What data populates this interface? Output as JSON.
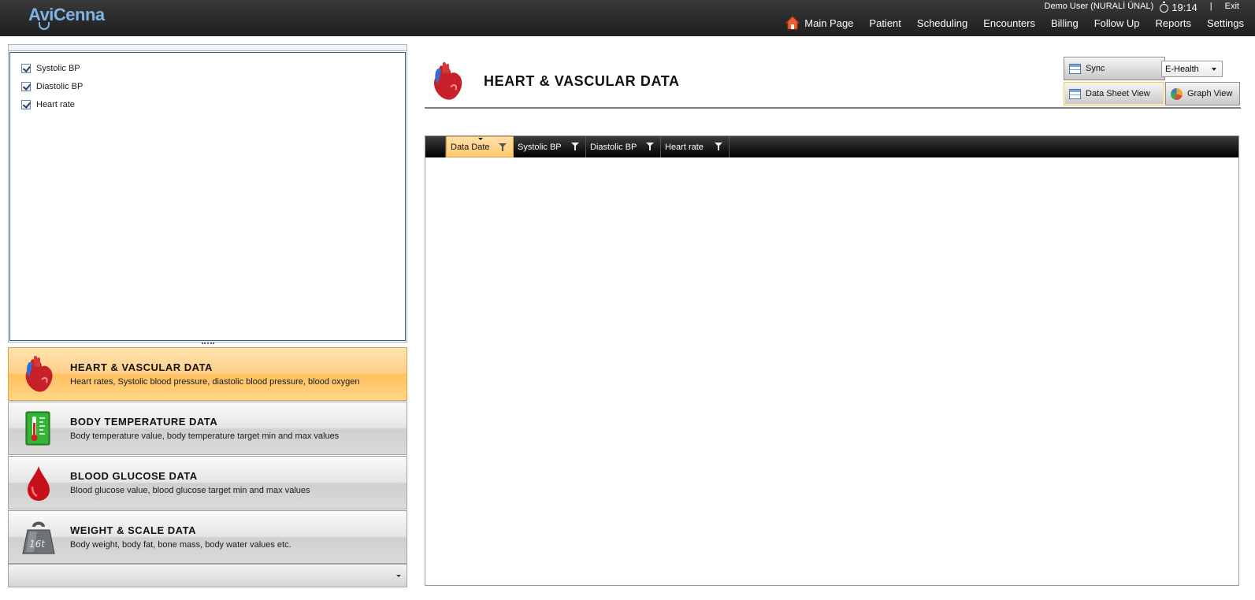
{
  "app": {
    "logo": "AviCenna"
  },
  "user": {
    "name": "Demo User (NURALİ ÜNAL)",
    "time": "19:14",
    "separator": "|",
    "exit_label": "Exit"
  },
  "nav": {
    "home": "Main Page",
    "patient": "Patient",
    "scheduling": "Scheduling",
    "encounters": "Encounters",
    "billing": "Billing",
    "follow_up": "Follow Up",
    "reports": "Reports",
    "settings": "Settings"
  },
  "series_filter": {
    "items": [
      {
        "label": "Systolic BP",
        "checked": true
      },
      {
        "label": "Diastolic BP",
        "checked": true
      },
      {
        "label": "Heart rate",
        "checked": true
      }
    ]
  },
  "categories": [
    {
      "title": "HEART & VASCULAR DATA",
      "desc": "Heart rates, Systolic blood pressure, diastolic blood pressure, blood oxygen",
      "icon": "heart-icon",
      "active": true
    },
    {
      "title": "BODY TEMPERATURE DATA",
      "desc": "Body temperature value, body temperature target min and max values",
      "icon": "thermometer-icon",
      "active": false
    },
    {
      "title": "BLOOD GLUCOSE DATA",
      "desc": "Blood glucose value, blood glucose target min and max values",
      "icon": "blood-drop-icon",
      "active": false
    },
    {
      "title": "WEIGHT & SCALE DATA",
      "desc": "Body weight, body fat, bone mass, body water values etc.",
      "icon": "weight-icon",
      "active": false
    }
  ],
  "page": {
    "title": "HEART & VASCULAR DATA"
  },
  "toolbar": {
    "sync_label": "Sync",
    "source_selected": "E-Health",
    "data_sheet_label": "Data Sheet View",
    "graph_label": "Graph View",
    "active_view": "Data Sheet View"
  },
  "grid": {
    "columns": [
      "Data Date",
      "Systolic BP",
      "Diastolic BP",
      "Heart rate"
    ],
    "sorted_column": "Data Date",
    "rows": []
  },
  "colors": {
    "accent": "#ffca70",
    "logo": "#7fb3e8",
    "topbar": "#2a2a2a"
  }
}
